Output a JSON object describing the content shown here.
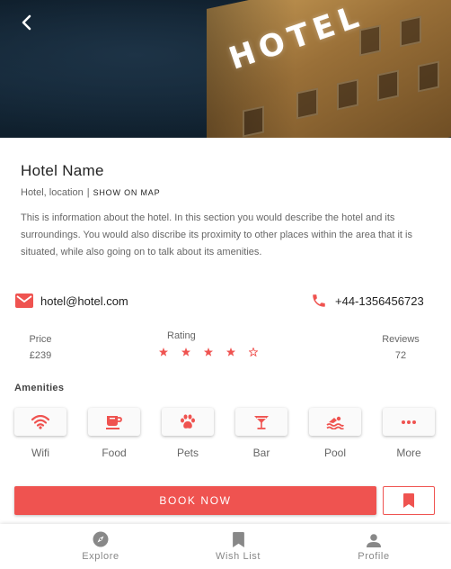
{
  "hero": {
    "sign_text": "HOTEL"
  },
  "hotel": {
    "name": "Hotel Name",
    "location": "Hotel, location",
    "separator": "|",
    "show_map_label": "SHOW ON MAP",
    "description": "This is information about the hotel. In this section you would describe the hotel and its surroundings. You would also discribe its proximity to other places within the area that it is situated, while also going on to talk about its amenities."
  },
  "contact": {
    "email": "hotel@hotel.com",
    "phone": "+44-1356456723"
  },
  "stats": {
    "price_label": "Price",
    "price_value": "£239",
    "rating_label": "Rating",
    "rating_value": 4,
    "rating_max": 5,
    "reviews_label": "Reviews",
    "reviews_value": "72"
  },
  "amenities": {
    "title": "Amenities",
    "items": [
      {
        "label": "Wifi",
        "icon": "wifi-icon"
      },
      {
        "label": "Food",
        "icon": "coffee-cup-icon"
      },
      {
        "label": "Pets",
        "icon": "paw-icon"
      },
      {
        "label": "Bar",
        "icon": "cocktail-icon"
      },
      {
        "label": "Pool",
        "icon": "swimming-icon"
      },
      {
        "label": "More",
        "icon": "more-dots-icon"
      }
    ]
  },
  "actions": {
    "book_label": "BOOK NOW"
  },
  "nav": {
    "items": [
      {
        "label": "Explore",
        "icon": "compass-icon"
      },
      {
        "label": "Wish List",
        "icon": "bookmark-icon"
      },
      {
        "label": "Profile",
        "icon": "person-icon"
      }
    ]
  },
  "colors": {
    "accent": "#ef5350",
    "nav_icon": "#888888",
    "text_muted": "#666666"
  }
}
